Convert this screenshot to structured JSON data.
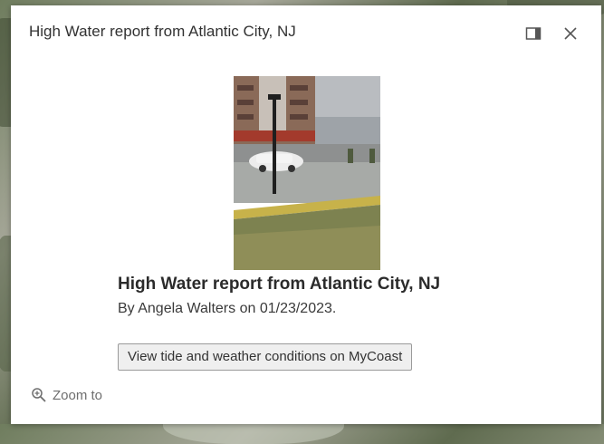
{
  "popup": {
    "title": "High Water report from Atlantic City, NJ",
    "dock_icon": "dock-icon",
    "close_icon": "close-icon"
  },
  "content": {
    "image_alt": "Street flooding photo",
    "title": "High Water report from Atlantic City, NJ",
    "byline": "By Angela Walters on 01/23/2023.",
    "button_label": "View tide and weather conditions on MyCoast"
  },
  "footer": {
    "zoom_icon": "zoom-in-icon",
    "zoom_label": "Zoom to"
  },
  "colors": {
    "popup_bg": "#ffffff",
    "text": "#323232",
    "button_bg": "#efefef",
    "muted": "#6e6e6e"
  }
}
